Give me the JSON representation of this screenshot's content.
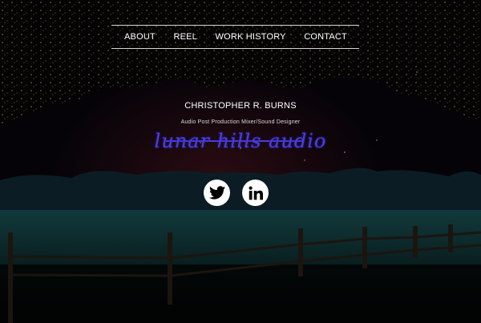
{
  "nav": {
    "items": [
      {
        "label": "ABOUT"
      },
      {
        "label": "REEL"
      },
      {
        "label": "WORK HISTORY"
      },
      {
        "label": "CONTACT"
      }
    ]
  },
  "hero": {
    "name": "CHRISTOPHER R. BURNS",
    "role": "Audio Post Production Mixer/Sound Designer",
    "logo_text": "lunar hills audio"
  },
  "social": [
    {
      "icon": "twitter-icon"
    },
    {
      "icon": "linkedin-icon"
    }
  ],
  "colors": {
    "accent_logo": "#4a3fd8",
    "top_strip": "#e6c58f"
  }
}
